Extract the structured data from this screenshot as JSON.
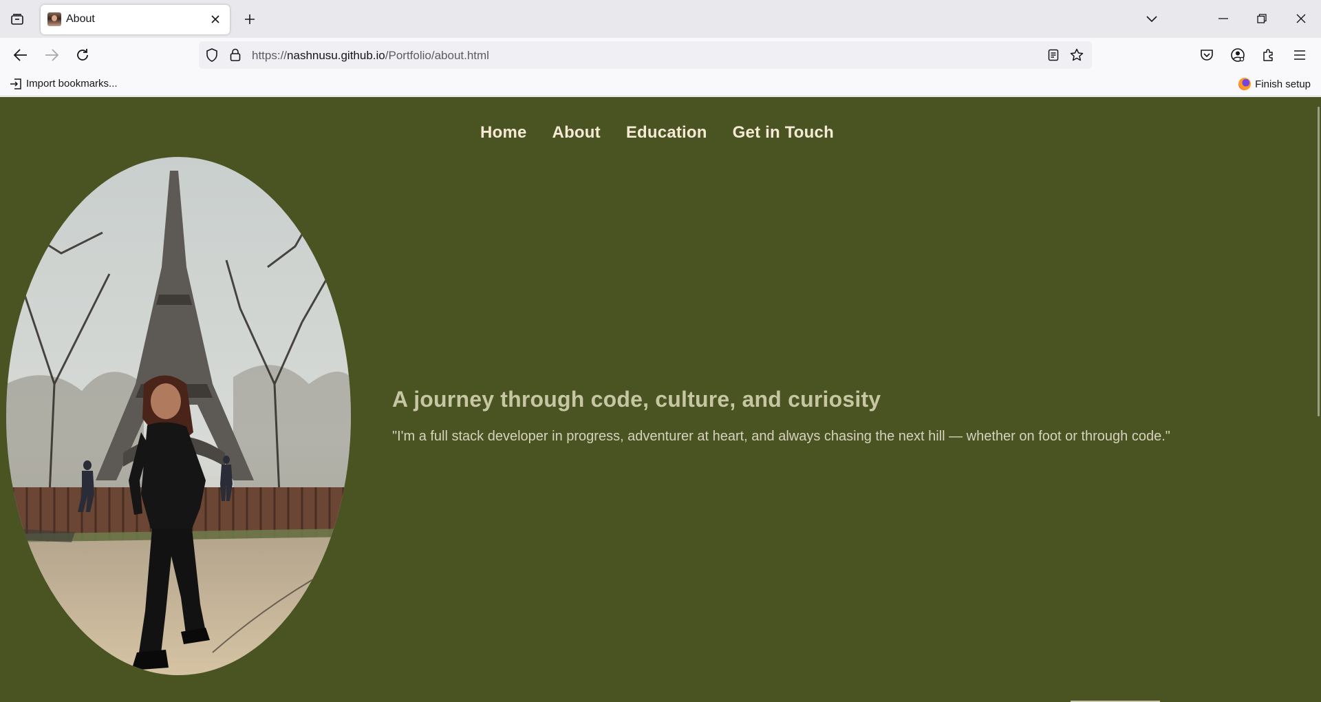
{
  "browser": {
    "tab": {
      "title": "About"
    },
    "url": {
      "protocol": "https://",
      "host": "nashnusu.github.io",
      "path": "/Portfolio/about.html"
    },
    "bookmarks": {
      "import_label": "Import bookmarks...",
      "finish_setup_label": "Finish setup"
    },
    "icons": [
      "tab-manager-icon",
      "close-icon",
      "plus-icon",
      "chevron-down-icon",
      "minimize-icon",
      "restore-icon",
      "back-icon",
      "forward-icon",
      "reload-icon",
      "shield-icon",
      "lock-icon",
      "reader-view-icon",
      "star-icon",
      "pocket-icon",
      "account-icon",
      "extensions-icon",
      "menu-icon",
      "import-icon",
      "firefox-icon"
    ]
  },
  "site": {
    "nav": [
      {
        "label": "Home"
      },
      {
        "label": "About"
      },
      {
        "label": "Education"
      },
      {
        "label": "Get in Touch"
      }
    ],
    "hero": {
      "heading": "A journey through code, culture, and curiosity",
      "quote": "\"I'm a full stack developer in progress, adventurer at heart, and always chasing the next hill — whether on foot or through code.\""
    }
  },
  "colors": {
    "page_background": "#4a5322",
    "nav_text": "#f4ead6",
    "heading_text": "#c7c6a3",
    "quote_text": "#d6d2bd",
    "tabstrip": "#e9e9ed",
    "toolbar": "#f9f9fb"
  }
}
